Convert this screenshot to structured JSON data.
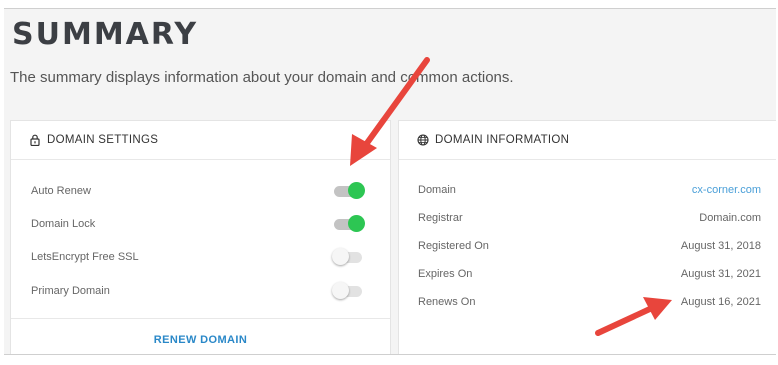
{
  "header": {
    "title": "SUMMARY",
    "description": "The summary displays information about your domain and common actions."
  },
  "settings": {
    "heading": "DOMAIN SETTINGS",
    "icon": "lock-icon",
    "items": [
      {
        "label": "Auto Renew",
        "enabled": true
      },
      {
        "label": "Domain Lock",
        "enabled": true
      },
      {
        "label": "LetsEncrypt Free SSL",
        "enabled": false
      },
      {
        "label": "Primary Domain",
        "enabled": false
      }
    ],
    "action_label": "RENEW DOMAIN"
  },
  "info": {
    "heading": "DOMAIN INFORMATION",
    "icon": "globe-icon",
    "rows": [
      {
        "label": "Domain",
        "value": "cx-corner.com"
      },
      {
        "label": "Registrar",
        "value": "Domain.com"
      },
      {
        "label": "Registered On",
        "value": "August 31, 2018"
      },
      {
        "label": "Expires On",
        "value": "August 31, 2021"
      },
      {
        "label": "Renews On",
        "value": "August 16, 2021"
      }
    ]
  },
  "colors": {
    "toggle_on": "#2dc653",
    "link": "#2a88c8",
    "annotation_arrow": "#e8453c"
  }
}
